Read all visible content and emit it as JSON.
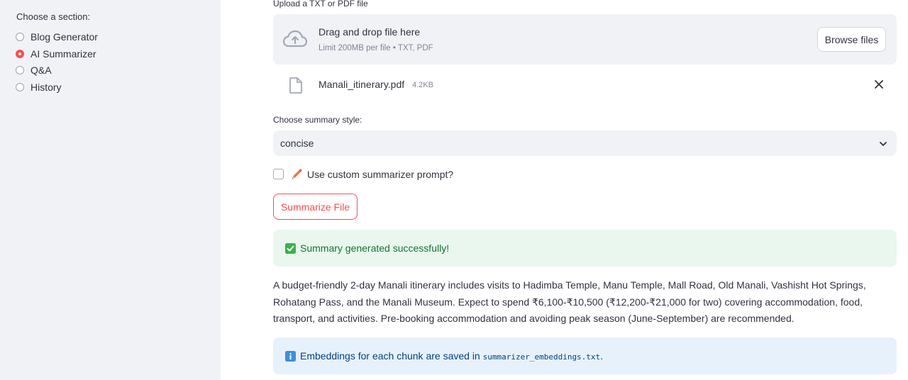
{
  "sidebar": {
    "label": "Choose a section:",
    "items": [
      {
        "label": "Blog Generator",
        "selected": false
      },
      {
        "label": "AI Summarizer",
        "selected": true
      },
      {
        "label": "Q&A",
        "selected": false
      },
      {
        "label": "History",
        "selected": false
      }
    ]
  },
  "uploader": {
    "label": "Upload a TXT or PDF file",
    "drag_text": "Drag and drop file here",
    "limit_text": "Limit 200MB per file • TXT, PDF",
    "browse_label": "Browse files",
    "icon": "cloud-upload-icon"
  },
  "uploaded_file": {
    "name": "Manali_itinerary.pdf",
    "size": "4.2KB",
    "icon": "file-icon"
  },
  "summary_style": {
    "label": "Choose summary style:",
    "value": "concise"
  },
  "custom_prompt": {
    "label": "Use custom summarizer prompt?",
    "checked": false,
    "icon": "pencil-icon"
  },
  "summarize_button": "Summarize File",
  "success": {
    "text": "Summary generated successfully!",
    "icon": "check-box-icon"
  },
  "summary_output": "A budget-friendly 2-day Manali itinerary includes visits to Hadimba Temple, Manu Temple, Mall Road, Old Manali, Vashisht Hot Springs, Rohatang Pass, and the Manali Museum. Expect to spend ₹6,100-₹10,500 (₹12,200-₹21,000 for two) covering accommodation, food, transport, and activities. Pre-booking accommodation and avoiding peak season (June-September) are recommended.",
  "info": {
    "prefix": "Embeddings for each chunk are saved in",
    "filename": "summarizer_embeddings.txt",
    "suffix": ".",
    "icon": "info-icon"
  },
  "colors": {
    "accent": "#ff4b4b",
    "sidebar_bg": "#f0f2f6",
    "success_bg": "#e9f7ee",
    "success_text": "#177233",
    "info_bg": "#e7f1fb",
    "info_text": "#004280"
  }
}
